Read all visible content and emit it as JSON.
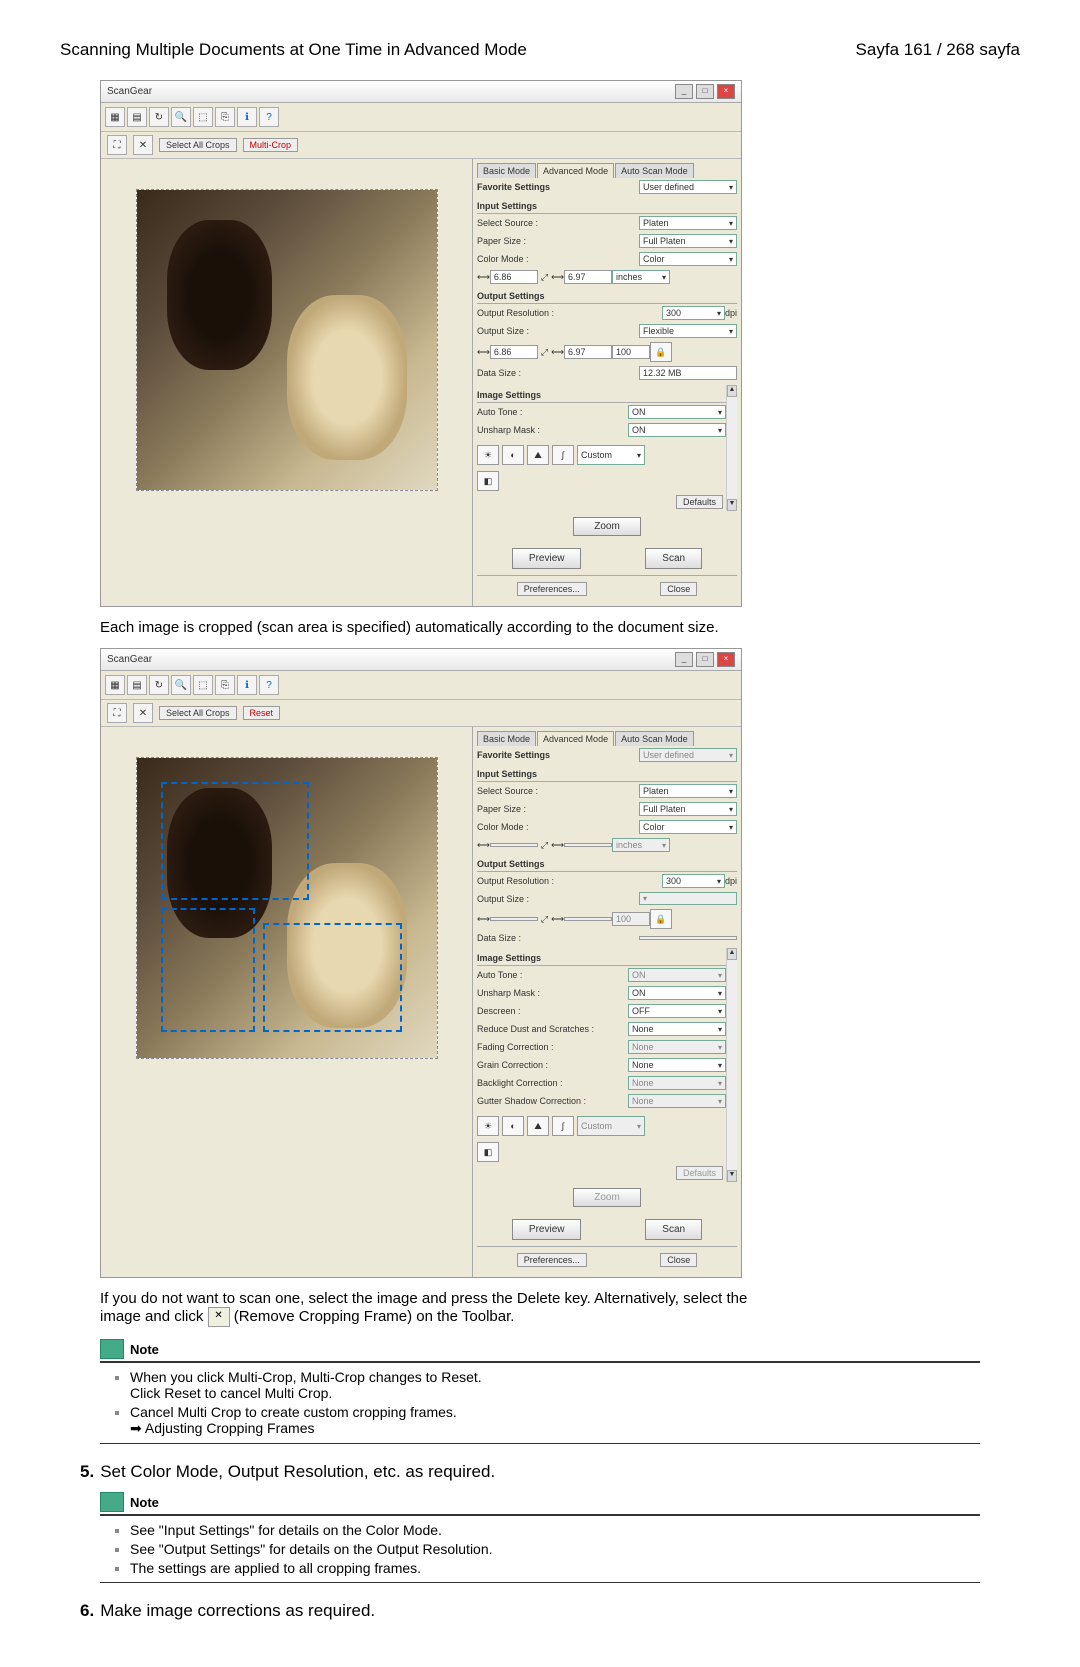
{
  "header": {
    "left": "Scanning Multiple Documents at One Time in Advanced Mode",
    "right": "Sayfa 161 / 268 sayfa"
  },
  "app": {
    "title": "ScanGear",
    "subbar": {
      "selectAll": "Select All Crops",
      "multiCrop": "Multi-Crop",
      "reset": "Reset"
    },
    "tabs": {
      "basic": "Basic Mode",
      "advanced": "Advanced Mode",
      "auto": "Auto Scan Mode"
    },
    "fav": {
      "label": "Favorite Settings",
      "value": "User defined"
    },
    "input": {
      "hdr": "Input Settings",
      "source": "Select Source :",
      "sourceV": "Platen",
      "paper": "Paper Size :",
      "paperV": "Full Platen",
      "color": "Color Mode :",
      "colorV": "Color",
      "w": "6.86",
      "h": "6.97",
      "units": "inches"
    },
    "output": {
      "hdr": "Output Settings",
      "res": "Output Resolution :",
      "resV": "300",
      "dpi": "dpi",
      "size": "Output Size :",
      "sizeV": "Flexible",
      "w": "6.86",
      "h": "6.97",
      "pct": "100",
      "data": "Data Size :",
      "dataV": "12.32 MB"
    },
    "image": {
      "hdr": "Image Settings",
      "auto": "Auto Tone :",
      "autoV": "ON",
      "unsharp": "Unsharp Mask :",
      "unsharpV": "ON",
      "descreen": "Descreen :",
      "descreenV": "OFF",
      "dust": "Reduce Dust and Scratches :",
      "dustV": "None",
      "fading": "Fading Correction :",
      "fadingV": "None",
      "grain": "Grain Correction :",
      "grainV": "None",
      "back": "Backlight Correction :",
      "backV": "None",
      "gutter": "Gutter Shadow Correction :",
      "gutterV": "None"
    },
    "custom": "Custom",
    "defaults": "Defaults",
    "zoom": "Zoom",
    "preview": "Preview",
    "scan": "Scan",
    "prefs": "Preferences...",
    "close": "Close"
  },
  "body": {
    "cropText": "Each image is cropped (scan area is specified) automatically according to the document size.",
    "delete1": "If you do not want to scan one, select the image and press the Delete key. Alternatively, select the",
    "delete2": "image and click ",
    "delete3": " (Remove Cropping Frame) on the Toolbar."
  },
  "note": {
    "label": "Note"
  },
  "note1": {
    "a": "When you click Multi-Crop, Multi-Crop changes to Reset.",
    "b": "Click Reset to cancel Multi Crop.",
    "c": "Cancel Multi Crop to create custom cropping frames.",
    "link": "Adjusting Cropping Frames"
  },
  "step5": {
    "num": "5.",
    "text": "Set Color Mode, Output Resolution, etc. as required."
  },
  "note2": {
    "a1": "See \"",
    "a2": "Input Settings",
    "a3": "\" for details on the Color Mode.",
    "b1": "See \"",
    "b2": "Output Settings",
    "b3": "\" for details on the Output Resolution.",
    "c": "The settings are applied to all cropping frames."
  },
  "step6": {
    "num": "6.",
    "text": "Make image corrections as required."
  }
}
